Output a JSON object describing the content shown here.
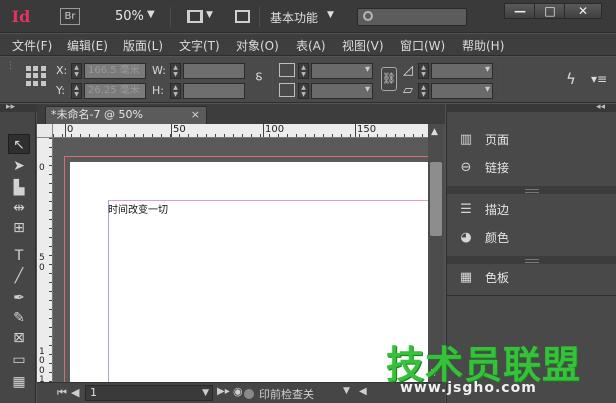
{
  "app": {
    "logo": "Id",
    "bridge_label": "Br",
    "zoom": "50%",
    "workspace": "基本功能",
    "search_placeholder": ""
  },
  "window_controls": {
    "minimize": "—",
    "maximize": "□",
    "close": "✕"
  },
  "menu": [
    "文件(F)",
    "编辑(E)",
    "版面(L)",
    "文字(T)",
    "对象(O)",
    "表(A)",
    "视图(V)",
    "窗口(W)",
    "帮助(H)"
  ],
  "control": {
    "x_label": "X:",
    "x_value": "166.5 毫米",
    "y_label": "Y:",
    "y_value": "26.25 毫米",
    "w_label": "W:",
    "w_value": "",
    "h_label": "H:",
    "h_value": ""
  },
  "document": {
    "tab_title": "*未命名-7 @ 50%",
    "close_label": "×",
    "page_text": "时间改变一切"
  },
  "ruler": {
    "h_labels": [
      "0",
      "50",
      "100",
      "150"
    ],
    "v_labels": [
      "0",
      "5",
      "0",
      "1",
      "0",
      "0",
      "1",
      "5"
    ]
  },
  "status": {
    "page_number": "1",
    "preflight": "印前检查关"
  },
  "panels": [
    {
      "icon": "pages-icon",
      "label": "页面"
    },
    {
      "icon": "links-icon",
      "label": "链接"
    },
    {
      "icon": "stroke-icon",
      "label": "描边"
    },
    {
      "icon": "color-icon",
      "label": "颜色"
    },
    {
      "icon": "swatches-icon",
      "label": "色板"
    }
  ],
  "watermark": {
    "title": "技术员联盟",
    "url": "www.jsgho.com"
  },
  "colors": {
    "app_logo": "#e4325f",
    "bleed": "#d46f6f",
    "margin_top": "#e59bc8",
    "margin_left": "#a9a6e4",
    "watermark": "#35c23a"
  }
}
